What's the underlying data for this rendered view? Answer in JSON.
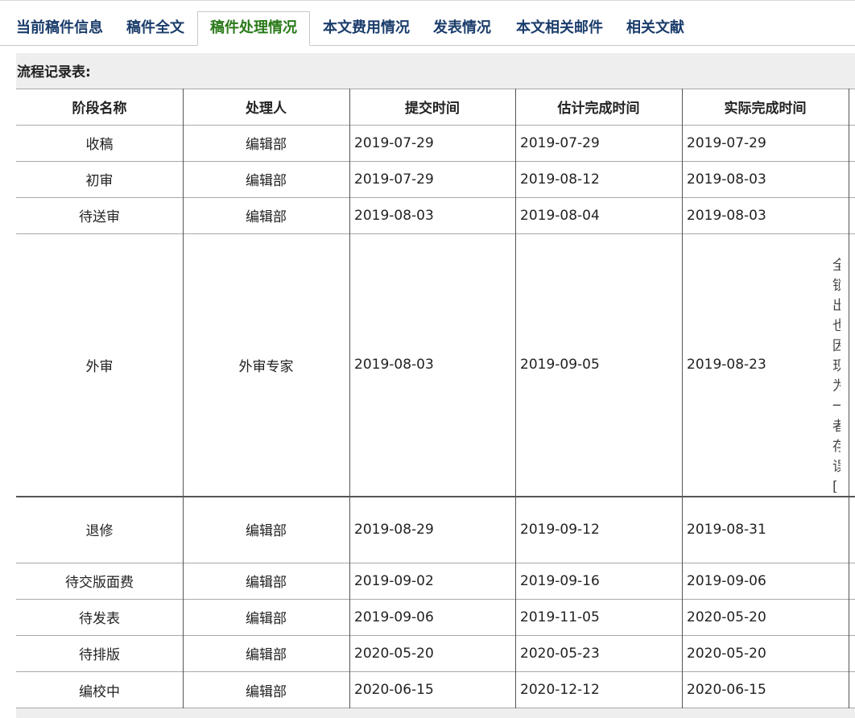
{
  "tabs": [
    {
      "label": "当前稿件信息"
    },
    {
      "label": "稿件全文"
    },
    {
      "label": "稿件处理情况"
    },
    {
      "label": "本文费用情况"
    },
    {
      "label": "发表情况"
    },
    {
      "label": "本文相关邮件"
    },
    {
      "label": "相关文献"
    }
  ],
  "active_tab": "稿件处理情况",
  "section_title": "流程记录表:",
  "table": {
    "headers": [
      "阶段名称",
      "处理人",
      "提交时间",
      "估计完成时间",
      "实际完成时间"
    ],
    "rows": [
      [
        "收稿",
        "编辑部",
        "2019-07-29",
        "2019-07-29",
        "2019-07-29"
      ],
      [
        "初审",
        "编辑部",
        "2019-07-29",
        "2019-08-12",
        "2019-08-03"
      ],
      [
        "待送审",
        "编辑部",
        "2019-08-03",
        "2019-08-04",
        "2019-08-03"
      ],
      [
        "外审",
        "外审专家",
        "2019-08-03",
        "2019-09-05",
        "2019-08-23"
      ],
      [
        "退修",
        "编辑部",
        "2019-08-29",
        "2019-09-12",
        "2019-08-31"
      ],
      [
        "待交版面费",
        "编辑部",
        "2019-09-02",
        "2019-09-16",
        "2019-09-06"
      ],
      [
        "待发表",
        "编辑部",
        "2019-09-06",
        "2019-11-05",
        "2020-05-20"
      ],
      [
        "待排版",
        "编辑部",
        "2020-05-20",
        "2020-05-23",
        "2020-05-20"
      ],
      [
        "编校中",
        "编辑部",
        "2020-06-15",
        "2020-12-12",
        "2020-06-15"
      ]
    ]
  },
  "side_text": "全锁出也因现为一者存误[",
  "colors": {
    "tab_text": "#1b3d6b",
    "tab_active": "#2a7a1a",
    "panel_bg": "#eeeeee"
  }
}
